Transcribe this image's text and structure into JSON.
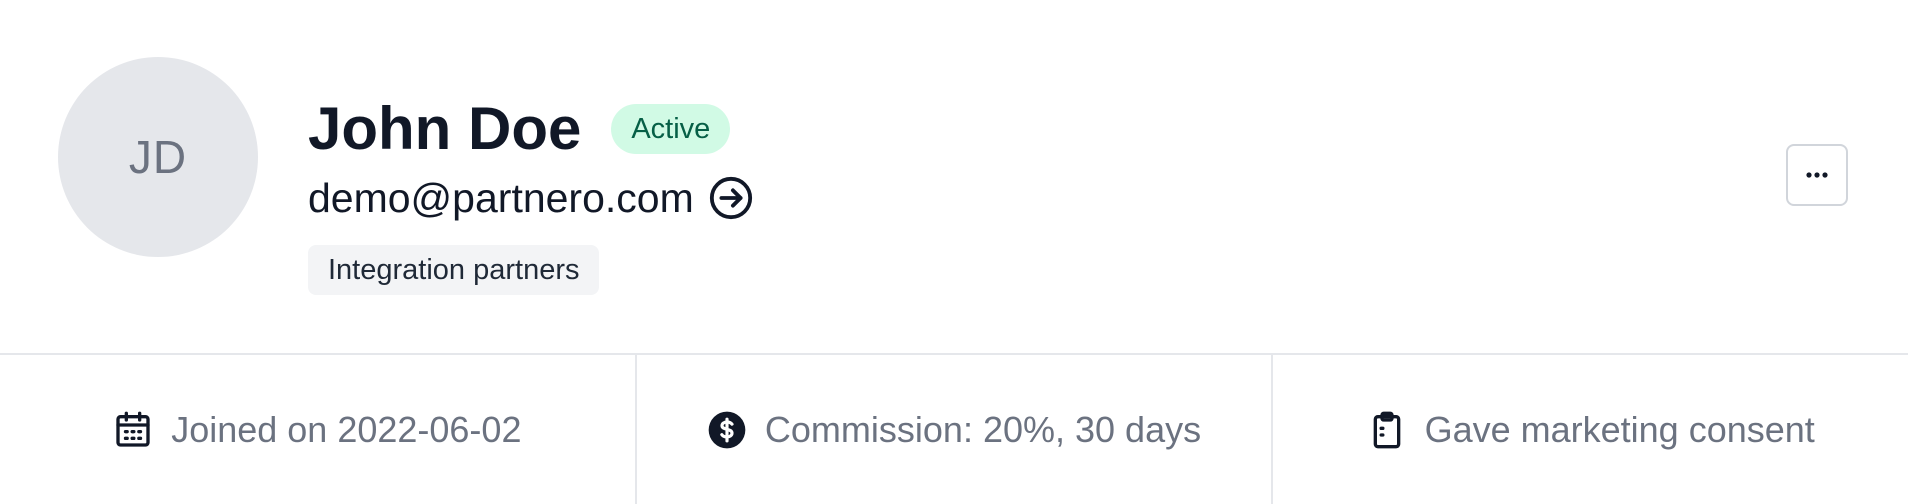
{
  "partner": {
    "initials": "JD",
    "name": "John Doe",
    "status": "Active",
    "email": "demo@partnero.com",
    "group": "Integration partners"
  },
  "actions": {
    "more_label": "···",
    "login_icon": "arrow-right-circle-icon"
  },
  "stats": {
    "joined": {
      "icon": "calendar-icon",
      "label": "Joined on 2022-06-02"
    },
    "commission": {
      "icon": "dollar-circle-icon",
      "label": "Commission: 20%, 30 days"
    },
    "consent": {
      "icon": "clipboard-icon",
      "label": "Gave marketing consent"
    }
  },
  "colors": {
    "status_bg": "#d1fae5",
    "status_text": "#065f46",
    "avatar_bg": "#e5e7eb"
  }
}
